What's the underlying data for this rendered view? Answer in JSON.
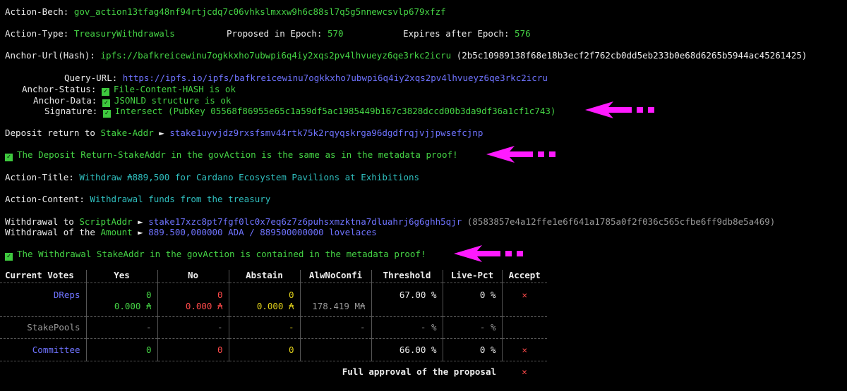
{
  "action": {
    "bech_label": "Action-Bech:",
    "bech": "gov_action13tfag48nf94rtjcdq7c06vhkslmxxw9h6c88sl7q5g5nnewcsvlp679xfzf",
    "type_label": "Action-Type:",
    "type": "TreasuryWithdrawals",
    "proposed_label": "Proposed in Epoch:",
    "proposed_epoch": "570",
    "expires_label": "Expires after Epoch:",
    "expires_epoch": "576",
    "anchor_label": "Anchor-Url(Hash):",
    "anchor_url": "ipfs://bafkreicewinu7ogkkxho7ubwpi6q4iy2xqs2pv4lhvueyz6qe3rkc2icru",
    "anchor_hash": "(2b5c10989138f68e18b3ecf2f762cb0dd5eb233b0e68d6265b5944ac45261425)",
    "query_label": "Query-URL:",
    "query_url": "https://ipfs.io/ipfs/bafkreicewinu7ogkkxho7ubwpi6q4iy2xqs2pv4lhvueyz6qe3rkc2icru",
    "status_label": "Anchor-Status:",
    "status_text": "File-Content-HASH is ok",
    "data_label": "Anchor-Data:",
    "data_text": "JSONLD structure is ok",
    "sig_label": "Signature:",
    "sig_text": "Intersect (PubKey 05568f86955e65c1a59df5ac1985449b167c3828dccd00b3da9df36a1cf1c743)",
    "deposit_label": "Deposit return to",
    "deposit_addr_type": "Stake-Addr",
    "deposit_addr": "stake1uyvjdz9rxsfsmv44rtk75k2rqyqskrga96dgdfrqjvjjpwsefcjnp",
    "deposit_proof": "The Deposit Return-StakeAddr in the govAction is the same as in the metadata proof!",
    "title_label": "Action-Title:",
    "title": "Withdraw ₳889,500 for Cardano Ecosystem Pavilions at Exhibitions",
    "content_label": "Action-Content:",
    "content": "Withdrawal funds from the treasury",
    "withdraw_to_label": "Withdrawal to",
    "withdraw_addr_type": "ScriptAddr",
    "withdraw_addr": "stake17xzc8pt7fgf0lc0x7eq6z7z6puhsxmzktna7dluahrj6g6ghh5qjr",
    "withdraw_addr_hex": "(8583857e4a12ffe1e6f641a1785a0f2f036c565cfbe6ff9db8e5a469)",
    "withdraw_of_label": "Withdrawal of the",
    "withdraw_amount_label": "Amount",
    "withdraw_amount": "889.500,000000 ADA / 889500000000 lovelaces",
    "withdraw_proof": "The Withdrawal StakeAddr in the govAction is contained in the metadata proof!",
    "arrow_sep": "►"
  },
  "votes": {
    "headers": [
      "Current Votes",
      "Yes",
      "No",
      "Abstain",
      "AlwNoConfi",
      "Threshold",
      "Live-Pct",
      "Accept"
    ],
    "dreps": {
      "label": "DReps",
      "yes": "0",
      "no": "0",
      "abstain": "0",
      "yes_ada": "0.000 ₳",
      "no_ada": "0.000 ₳",
      "abstain_ada": "0.000 ₳",
      "alwnoconfi": "178.419 M₳",
      "threshold": "67.00 %",
      "livepct": "0 %",
      "accept": "✕"
    },
    "stakepools": {
      "label": "StakePools",
      "yes": "-",
      "no": "-",
      "abstain": "-",
      "alwnoconfi": "-",
      "threshold": "- %",
      "livepct": "- %"
    },
    "committee": {
      "label": "Committee",
      "yes": "0",
      "no": "0",
      "abstain": "0",
      "threshold": "66.00 %",
      "livepct": "0 %",
      "accept": "✕"
    },
    "full_approval": "Full approval of the proposal",
    "full_accept": "✕"
  },
  "colors": {
    "arrow": "#ff1aff",
    "check": "#3ec93e"
  }
}
